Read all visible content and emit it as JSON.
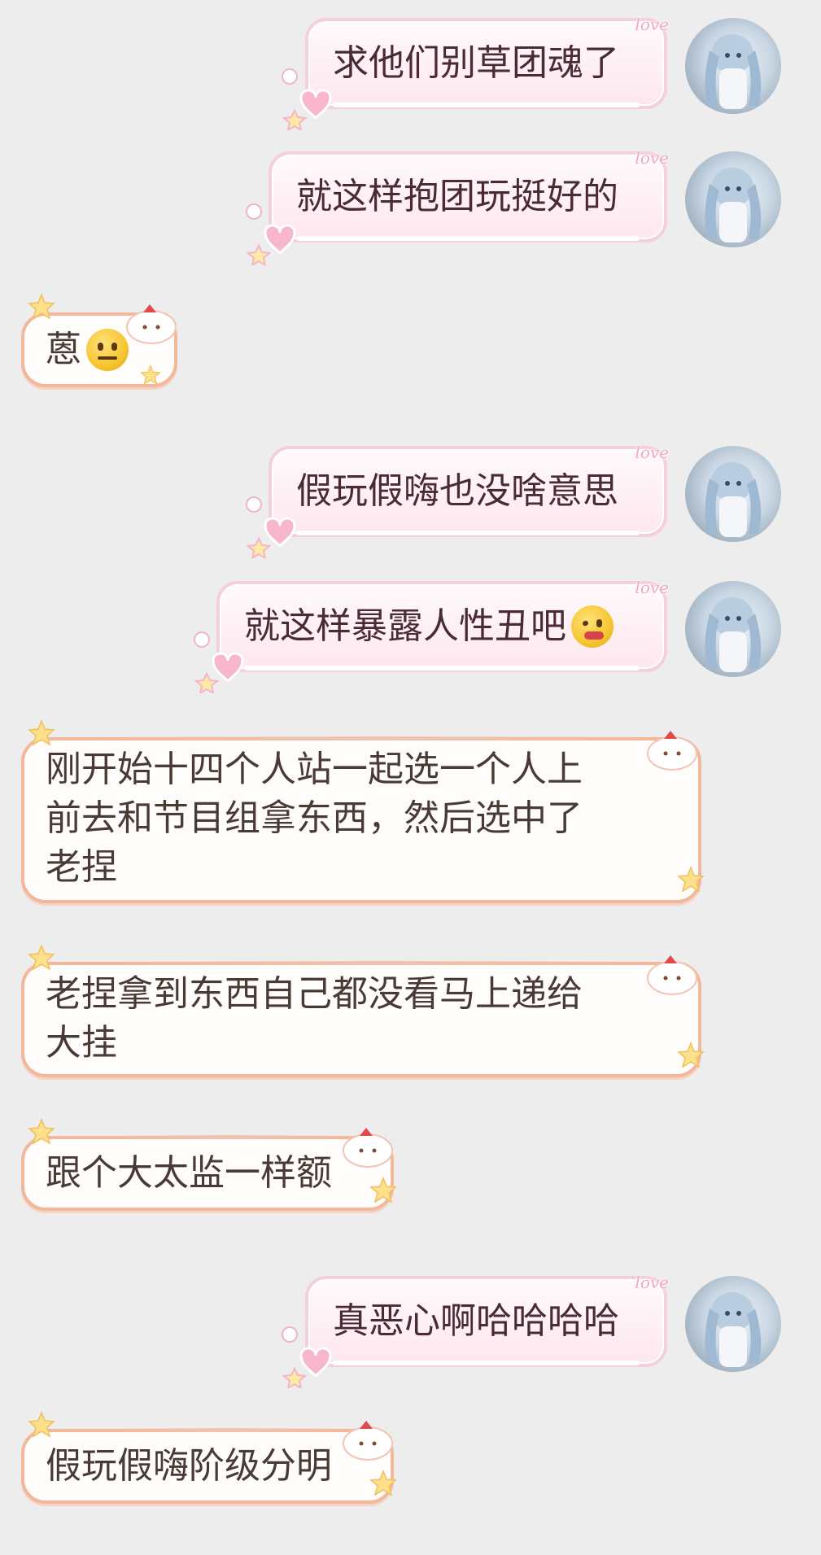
{
  "messages": [
    {
      "side": "out",
      "text": "求他们别草团魂了",
      "deco_label": "love"
    },
    {
      "side": "out",
      "text": "就这样抱团玩挺好的",
      "deco_label": "love"
    },
    {
      "side": "in",
      "text": "蒽",
      "emoji": "neutral-face"
    },
    {
      "side": "out",
      "text": "假玩假嗨也没啥意思",
      "deco_label": "love"
    },
    {
      "side": "out",
      "text": "就这样暴露人性丑吧",
      "emoji": "yum-face",
      "deco_label": "love"
    },
    {
      "side": "in",
      "lines": [
        "刚开始十四个人站一起选一个人上",
        "前去和节目组拿东西，然后选中了",
        "老捏"
      ]
    },
    {
      "side": "in",
      "lines": [
        "老捏拿到东西自己都没看马上递给",
        "大挂"
      ]
    },
    {
      "side": "in",
      "text": "跟个大太监一样额"
    },
    {
      "side": "out",
      "text": "真恶心啊哈哈哈哈",
      "deco_label": "love"
    },
    {
      "side": "in",
      "text": "假玩假嗨阶级分明"
    }
  ],
  "colors": {
    "background": "#ededed",
    "out_border": "#f4cfdc",
    "in_border": "#f2b89b"
  }
}
